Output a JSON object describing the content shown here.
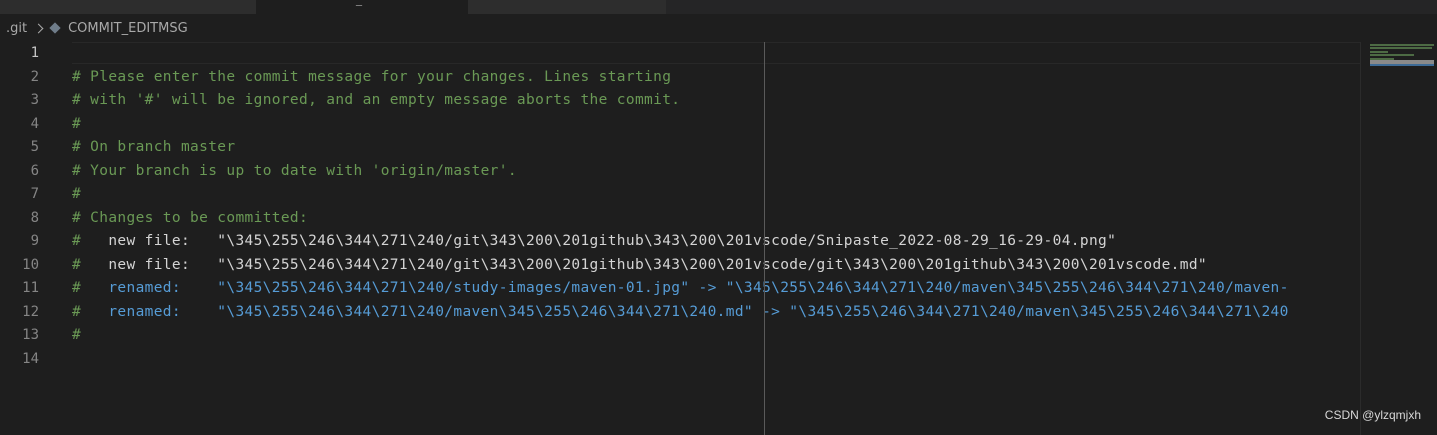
{
  "tabs": [
    {
      "label": "· ·"
    },
    {
      "label": "_"
    },
    {
      "label": "· ·"
    }
  ],
  "breadcrumb": {
    "folder": ".git",
    "file": "COMMIT_EDITMSG"
  },
  "editor": {
    "line_numbers": [
      "1",
      "2",
      "3",
      "4",
      "5",
      "6",
      "7",
      "8",
      "9",
      "10",
      "11",
      "12",
      "13",
      "14"
    ],
    "lines": [
      {
        "hash": "",
        "text": ""
      },
      {
        "hash": "#",
        "text": " Please enter the commit message for your changes. Lines starting"
      },
      {
        "hash": "#",
        "text": " with '#' will be ignored, and an empty message aborts the commit."
      },
      {
        "hash": "#",
        "text": ""
      },
      {
        "hash": "#",
        "text": " On branch master"
      },
      {
        "hash": "#",
        "text": " Your branch is up to date with 'origin/master'."
      },
      {
        "hash": "#",
        "text": ""
      },
      {
        "hash": "#",
        "text": " Changes to be committed:"
      },
      {
        "hash": "#",
        "text": "\tnew file:   \"\\345\\255\\246\\344\\271\\240/git\\343\\200\\201github\\343\\200\\201vscode/Snipaste_2022-08-29_16-29-04.png\""
      },
      {
        "hash": "#",
        "text": "\tnew file:   \"\\345\\255\\246\\344\\271\\240/git\\343\\200\\201github\\343\\200\\201vscode/git\\343\\200\\201github\\343\\200\\201vscode.md\""
      },
      {
        "hash": "#",
        "text": "\trenamed:    \"\\345\\255\\246\\344\\271\\240/study-images/maven-01.jpg\" -> \"\\345\\255\\246\\344\\271\\240/maven\\345\\255\\246\\344\\271\\240/maven-"
      },
      {
        "hash": "#",
        "text": "\trenamed:    \"\\345\\255\\246\\344\\271\\240/maven\\345\\255\\246\\344\\271\\240.md\" -> \"\\345\\255\\246\\344\\271\\240/maven\\345\\255\\246\\344\\271\\240"
      },
      {
        "hash": "#",
        "text": ""
      },
      {
        "hash": "",
        "text": ""
      }
    ]
  },
  "watermark": "CSDN @ylzqmjxh",
  "colors": {
    "background": "#1e1e1e",
    "comment": "#6a9955",
    "plain": "#d4d4d4",
    "renamed_blue": "#569cd6",
    "line_number": "#858585"
  }
}
